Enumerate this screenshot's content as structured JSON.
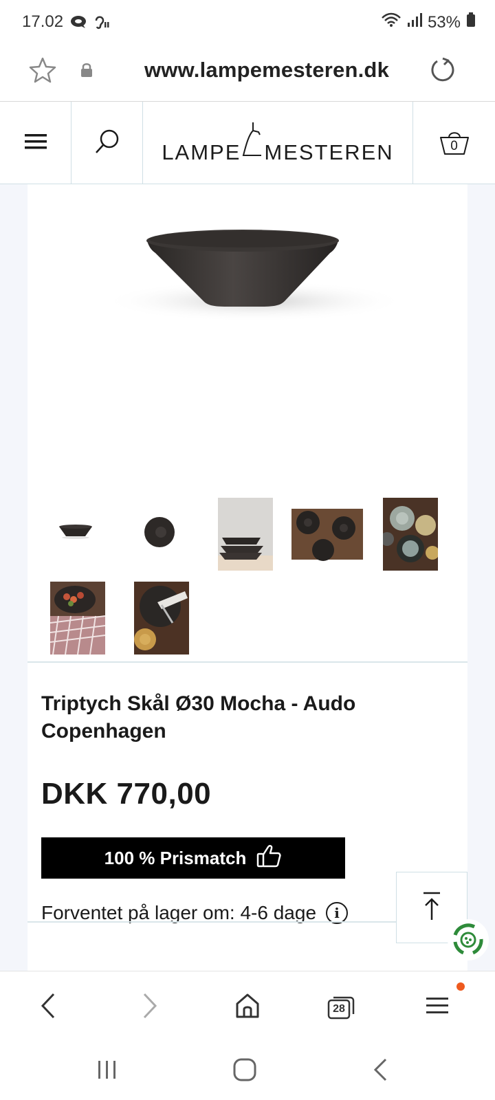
{
  "status_bar": {
    "time": "17.02",
    "battery": "53%"
  },
  "browser": {
    "url": "www.lampemesteren.dk",
    "tab_count": "28"
  },
  "site": {
    "logo_left": "LAMPE",
    "logo_right": "MESTEREN",
    "cart_count": "0"
  },
  "product": {
    "title": "Triptych Skål Ø30 Mocha - Audo Copenhagen",
    "price": "DKK 770,00",
    "prismatch_label": "100 % Prismatch",
    "stock_text": "Forventet på lager om: 4-6 dage",
    "info_glyph": "i"
  },
  "icons": {
    "status": [
      "chat-icon",
      "hearing-icon",
      "wifi-icon",
      "signal-icon",
      "battery-icon"
    ],
    "browser": [
      "star-icon",
      "lock-icon",
      "reload-icon"
    ],
    "header": [
      "menu-icon",
      "search-icon",
      "cart-icon"
    ],
    "product": [
      "thumbs-up-icon",
      "info-icon",
      "arrow-up-icon",
      "recycle-widget-icon"
    ],
    "browser_nav": [
      "back-icon",
      "forward-icon",
      "home-icon",
      "tabs-icon",
      "menu-icon"
    ],
    "system_nav": [
      "recents-icon",
      "home-circle-icon",
      "system-back-icon"
    ]
  },
  "colors": {
    "accent_border": "#cfdfe5",
    "page_bg": "#f4f6fb",
    "prismatch_bg": "#000000",
    "notif_dot": "#ee5a1e",
    "widget_green": "#2e8b3a"
  }
}
